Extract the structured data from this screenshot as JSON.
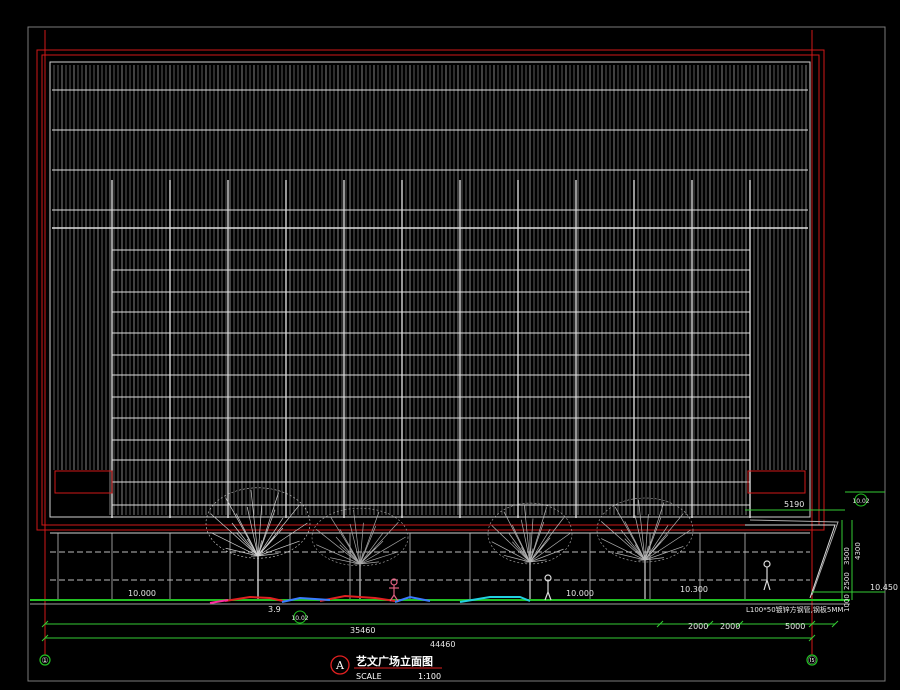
{
  "title": {
    "circle_letter": "A",
    "name": "艺文广场立面图",
    "scale_label": "SCALE",
    "scale_value": "1:100"
  },
  "dimensions": {
    "overall": "44460",
    "span_left": "35460",
    "seg_1": "2000",
    "seg_2": "2000",
    "seg_3": "5000",
    "top_right": "5190",
    "vert_1": "1000",
    "vert_2": "2500",
    "vert_3": "4300",
    "vert_4": "3500"
  },
  "elevations": {
    "e_left": "10.000",
    "e_mid": "10.000",
    "e_right_mid": "10.300",
    "e_right": "10.450",
    "e_low": "3.9"
  },
  "annotations": {
    "bench_note": "L100*50镀锌方钢管,钢板5MM",
    "ref_1": "10.02",
    "ref_2": "10.02",
    "axis_left": "①",
    "axis_right": "⑮"
  },
  "colors": {
    "frame_red": "#d01818",
    "grid_grey": "#c8c8c8",
    "ground_green": "#22c022",
    "dim_green": "#33cc33",
    "accent_blue": "#3a7bff",
    "accent_cyan": "#22d0e0",
    "accent_magenta": "#ff2aa0"
  }
}
